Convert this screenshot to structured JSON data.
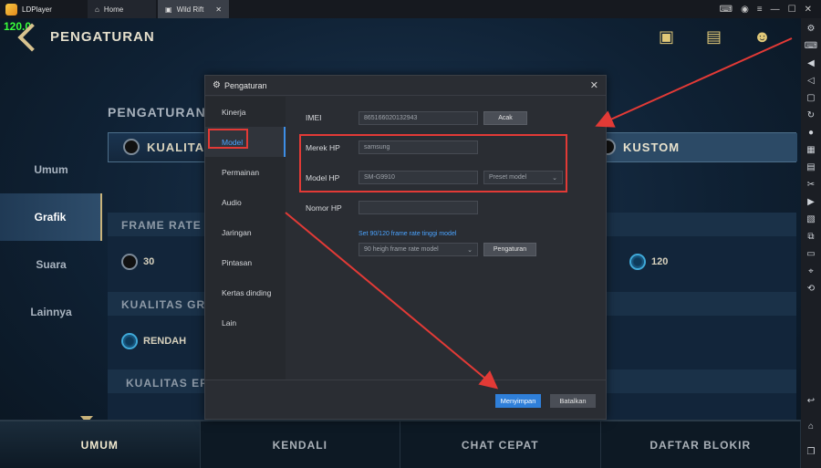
{
  "titlebar": {
    "app_name": "LDPlayer",
    "tabs": [
      {
        "label": "Home",
        "icon": "home-icon"
      },
      {
        "label": "Wild Rift",
        "icon": "game-icon",
        "close": "✕"
      }
    ]
  },
  "game": {
    "fps": "120.0",
    "title": "PENGATURAN",
    "section_title": "PENGATURAN",
    "quality_left": "KUALITAS",
    "quality_right": "KUSTOM",
    "side_nav": [
      "Umum",
      "Grafik",
      "Suara",
      "Lainnya"
    ],
    "frame_rate_label": "FRAME RATE",
    "frame_rate_low": "30",
    "frame_rate_high": "120",
    "graphics_label": "KUALITAS GRA",
    "graphics_value": "RENDAH",
    "effects_label": "KUALITAS EFE",
    "bottom_tabs": [
      "UMUM",
      "KENDALI",
      "CHAT CEPAT",
      "DAFTAR BLOKIR"
    ]
  },
  "dialog": {
    "title": "Pengaturan",
    "menu": [
      "Kinerja",
      "Model",
      "Permainan",
      "Audio",
      "Jaringan",
      "Pintasan",
      "Kertas dinding",
      "Lain"
    ],
    "imei_label": "IMEI",
    "imei_value": "865166020132943",
    "imei_button": "Acak",
    "brand_label": "Merek HP",
    "brand_value": "samsung",
    "model_label": "Model HP",
    "model_value": "SM-G9910",
    "preset_label": "Preset model",
    "phone_label": "Nomor HP",
    "phone_value": "",
    "framerate_link": "Set 90/120 frame rate tinggi model",
    "framerate_select": "90 heigh frame rate model",
    "framerate_button": "Pengaturan",
    "save": "Menyimpan",
    "cancel": "Batalkan"
  },
  "colors": {
    "accent_blue": "#2f7fd9",
    "highlight_red": "#e23a36",
    "fps_green": "#39ff3a"
  }
}
